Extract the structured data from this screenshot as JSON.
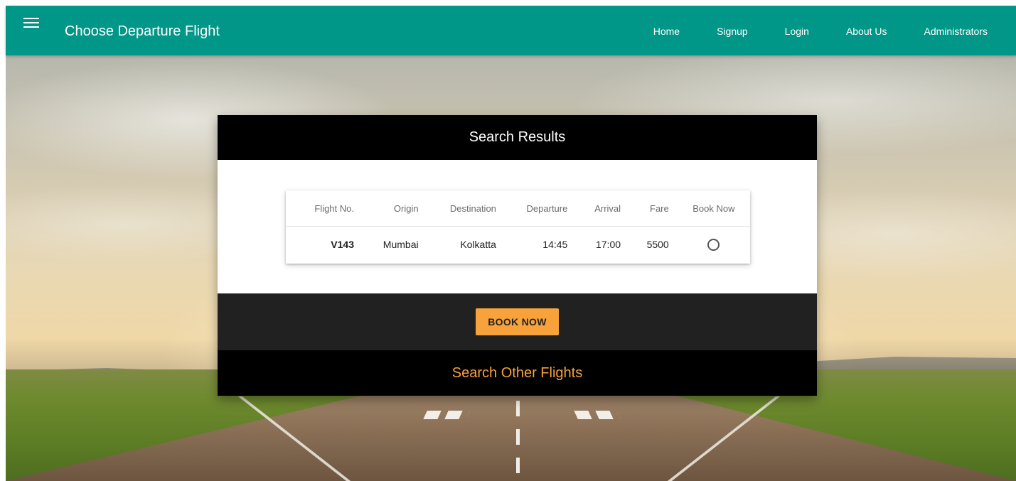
{
  "header": {
    "title": "Choose Departure Flight",
    "menu_icon": "hamburger-menu-icon",
    "nav": [
      "Home",
      "Signup",
      "Login",
      "About Us",
      "Administrators"
    ]
  },
  "results": {
    "heading": "Search Results",
    "columns": [
      "Flight No.",
      "Origin",
      "Destination",
      "Departure",
      "Arrival",
      "Fare",
      "Book Now"
    ],
    "rows": [
      {
        "flight_no": "V143",
        "origin": "Mumbai",
        "destination": "Kolkatta",
        "departure": "14:45",
        "arrival": "17:00",
        "fare": "5500"
      }
    ],
    "book_button": "BOOK NOW",
    "other_link": "Search Other Flights"
  },
  "colors": {
    "header_bg": "#009688",
    "accent": "#f7a23a",
    "card_head": "#000000",
    "card_actions": "#212121"
  }
}
